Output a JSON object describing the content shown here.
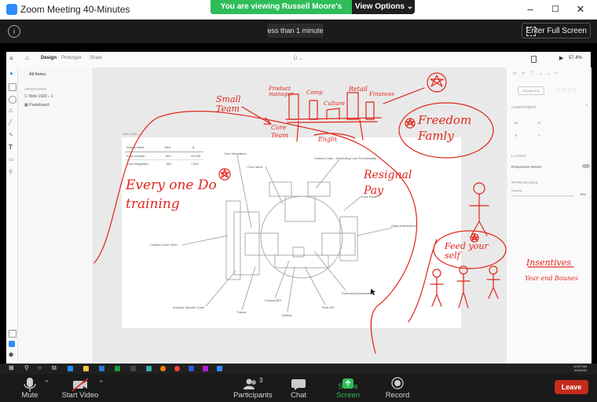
{
  "window": {
    "title": "Zoom Meeting 40-Minutes",
    "min_glyph": "–",
    "max_glyph": "☐",
    "close_glyph": "✕"
  },
  "share_banner": {
    "text": "You are viewing Russell Moore's screen",
    "options_label": "View Options ⌄"
  },
  "zoom_top": {
    "info_glyph": "i",
    "timer": "ess than 1 minute",
    "fullscreen_label": "Enter Full Screen"
  },
  "xd": {
    "tabs": [
      "Design",
      "Prototype",
      "Share"
    ],
    "doc_title": "Ü ⌄",
    "zoom_level": "57.4%",
    "layers_header": "All Items",
    "artboards_label": "ARTBOARDS",
    "layer_items": [
      "Web 1920 – 1",
      "Pasteboard"
    ],
    "artboard_name": "Web 1920 – 1",
    "repeat_grid": "Repeat Grid",
    "component_label": "COMPONENT",
    "layout_label": "LAYOUT",
    "responsive_resize": "Responsive Resize",
    "appearance_label": "APPEARANCE",
    "opacity_label": "Opacity",
    "opacity_value": "0%",
    "prop_w": "W",
    "prop_h": "H",
    "prop_x": "X",
    "prop_y": "Y",
    "table": {
      "headers": [
        "Way to Build",
        "Time",
        "$"
      ],
      "rows": [
        [
          "From scratch",
          "800",
          "40,000"
        ],
        [
          "Core integration",
          "150",
          "7,500"
        ]
      ]
    },
    "diagram_labels": {
      "core_integration": "Core Integration",
      "core_items": "Core Items",
      "custom_code": "Custom Code - Extending Core Functionality",
      "core_panel": "Core Panel",
      "class_instructions": "Class Instructions",
      "custom_code_view": "Custom Code View",
      "external_auth": "External Authentication",
      "industry_code": "Industry Specific Code",
      "theme": "Theme",
      "context_api": "Context API",
      "deriton": "Deriton",
      "rest_api": "Rest API"
    }
  },
  "annotations": {
    "small_team": "Small Team",
    "product_manager": "Product manager",
    "comp": "Comp",
    "culture": "Culture",
    "retail": "Retail",
    "finances": "Finances",
    "core_team": "Core Team",
    "engin": "Engin",
    "freedom_family": "Freedom Famly",
    "everyone_training": "Every one Do training",
    "residual_pay": "Resignal Pay",
    "feed_yourself": "Feed your self",
    "insentives": "Insentives",
    "year_end_bonus": "Year end Bounes"
  },
  "taskbar": {
    "time": "10:57 AM",
    "date": "8/4/2020"
  },
  "controls": {
    "mute": "Mute",
    "start_video": "Start Video",
    "participants": "Participants",
    "participants_count": "3",
    "chat": "Chat",
    "share_screen": "Share Screen",
    "record": "Record",
    "leave": "Leave"
  },
  "colors": {
    "ink": "#e0261b",
    "zoom_green": "#2ebd59",
    "leave_red": "#c42b1c",
    "zoom_blue": "#2d8cff"
  }
}
